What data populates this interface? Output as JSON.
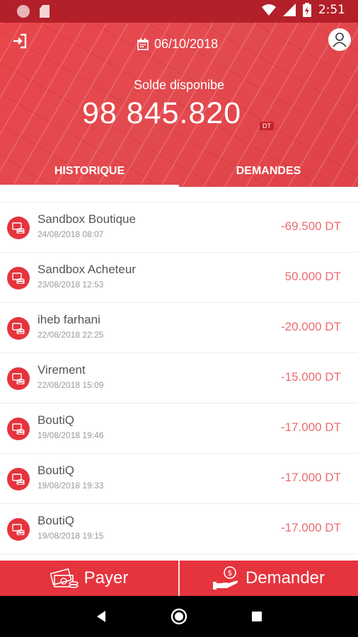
{
  "status_bar": {
    "time": "2:51"
  },
  "header": {
    "date": "06/10/2018",
    "balance_label": "Solde disponibe",
    "balance_amount": "98 845.820",
    "currency": "DT",
    "colors": {
      "primary": "#e5343d",
      "status": "#b3202a"
    }
  },
  "tabs": [
    {
      "label": "HISTORIQUE",
      "active": true
    },
    {
      "label": "DEMANDES",
      "active": false
    }
  ],
  "transactions": [
    {
      "name": "Sandbox Boutique",
      "date": "24/08/2018 08:07",
      "amount": "-69.500 DT"
    },
    {
      "name": "Sandbox Acheteur",
      "date": "23/08/2018 12:53",
      "amount": "50.000 DT"
    },
    {
      "name": "iheb farhani",
      "date": "22/08/2018 22:25",
      "amount": "-20.000 DT"
    },
    {
      "name": "Virement",
      "date": "22/08/2018 15:09",
      "amount": "-15.000 DT"
    },
    {
      "name": "BoutiQ",
      "date": "19/08/2018 19:46",
      "amount": "-17.000 DT"
    },
    {
      "name": "BoutiQ",
      "date": "19/08/2018 19:33",
      "amount": "-17.000 DT"
    },
    {
      "name": "BoutiQ",
      "date": "19/08/2018 19:15",
      "amount": "-17.000 DT"
    }
  ],
  "actions": {
    "pay_label": "Payer",
    "request_label": "Demander"
  },
  "icons": {
    "logout": "logout-icon",
    "calendar": "calendar-icon",
    "profile": "user-icon",
    "transaction": "coins-icon",
    "pay": "money-icon",
    "request": "hand-coin-icon"
  }
}
